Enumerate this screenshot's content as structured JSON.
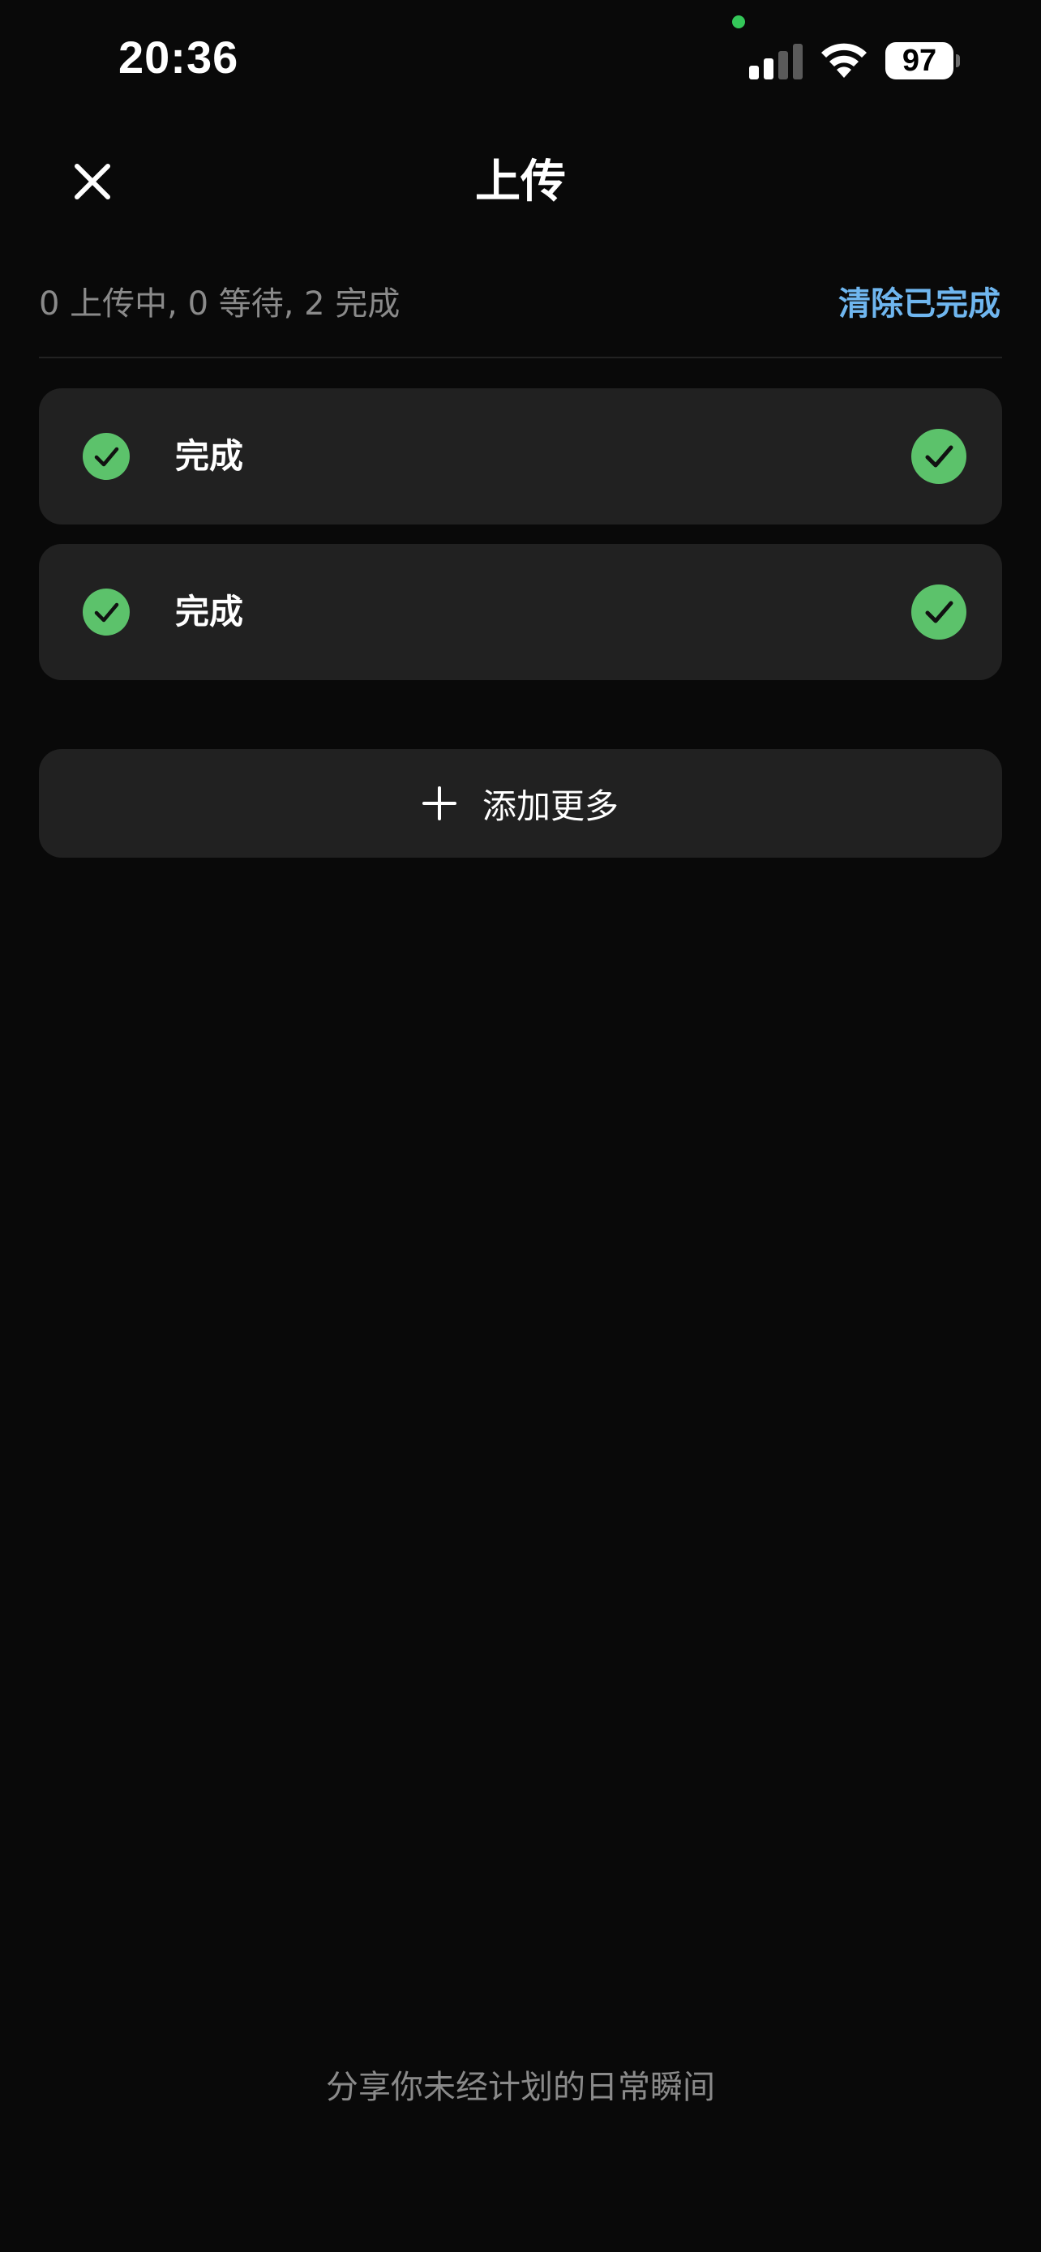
{
  "status_bar": {
    "time": "20:36",
    "battery": "97"
  },
  "header": {
    "title": "上传"
  },
  "summary": {
    "text": "0 上传中, 0 等待, 2 完成",
    "clear_label": "清除已完成"
  },
  "uploads": [
    {
      "label": "完成",
      "status": "done"
    },
    {
      "label": "完成",
      "status": "done"
    }
  ],
  "add_more": {
    "label": "添加更多"
  },
  "footer": {
    "tagline": "分享你未经计划的日常瞬间"
  },
  "colors": {
    "background": "#090909",
    "card": "#212121",
    "success": "#5cc26b",
    "link": "#6fb6ef",
    "muted_text": "#8a8a8a"
  }
}
